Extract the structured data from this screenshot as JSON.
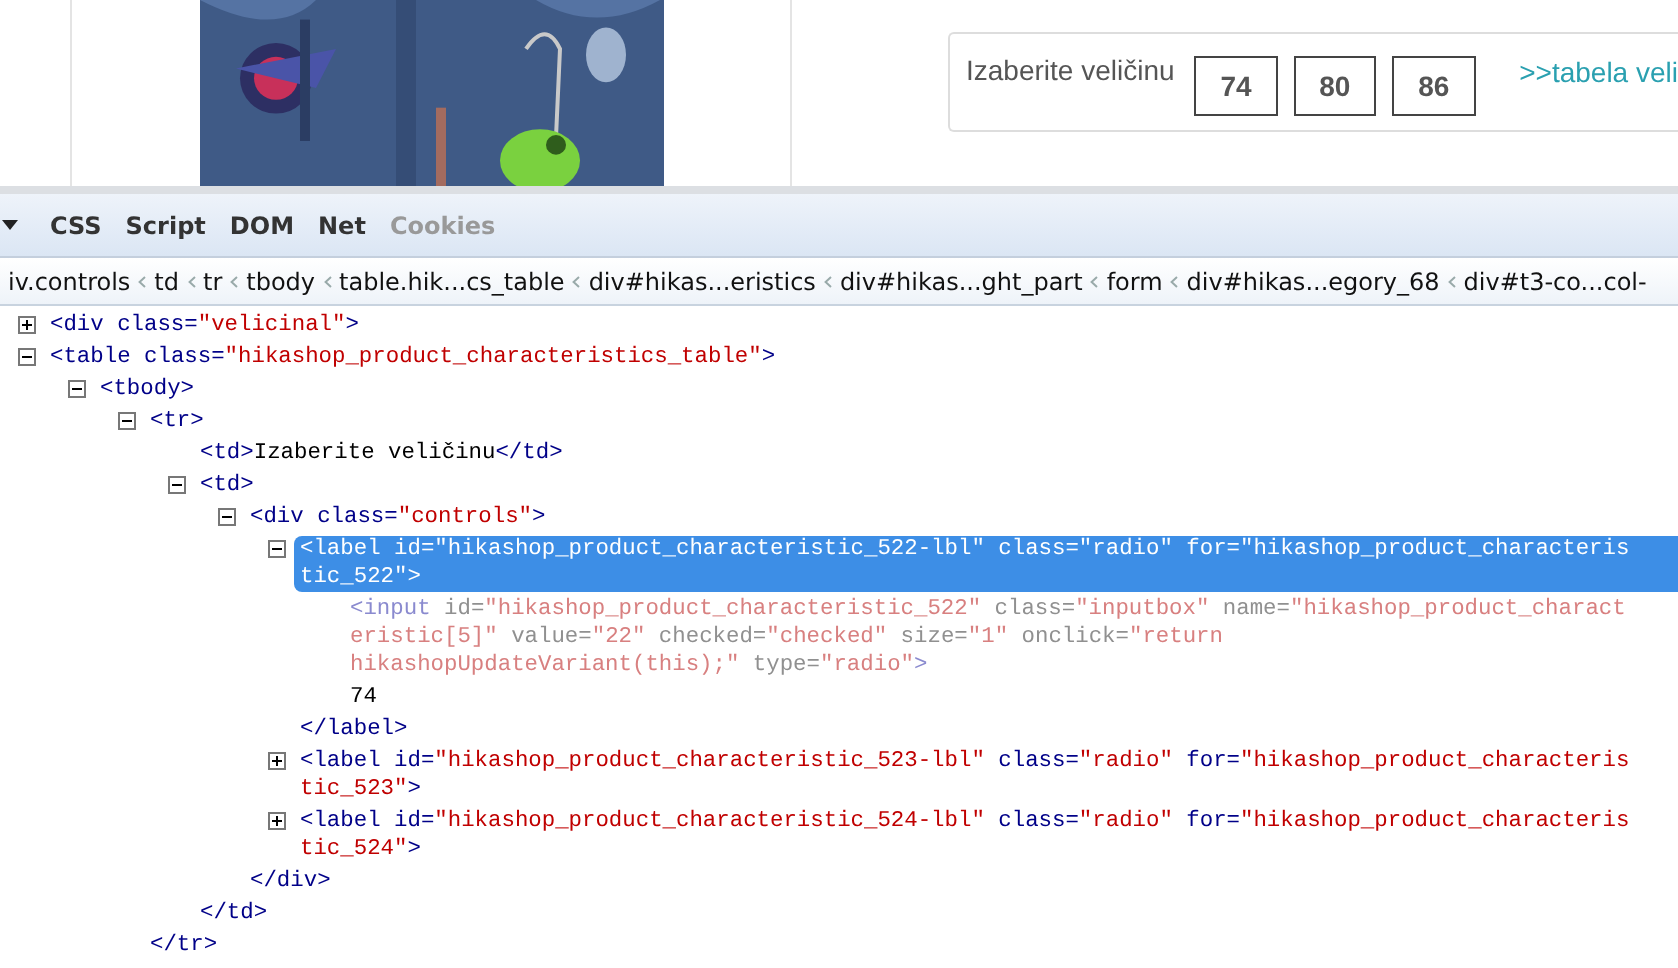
{
  "size_box": {
    "label": "Izaberite veličinu",
    "sizes": [
      "74",
      "80",
      "86"
    ],
    "link": ">>tabela veli"
  },
  "devtools": {
    "tabs": [
      {
        "label": "CSS",
        "disabled": false
      },
      {
        "label": "Script",
        "disabled": false
      },
      {
        "label": "DOM",
        "disabled": false
      },
      {
        "label": "Net",
        "disabled": false
      },
      {
        "label": "Cookies",
        "disabled": true
      }
    ],
    "breadcrumbs": [
      "iv.controls",
      "td",
      "tr",
      "tbody",
      "table.hik...cs_table",
      "div#hikas...eristics",
      "div#hikas...ght_part",
      "form",
      "div#hikas...egory_68",
      "div#t3-co...col-"
    ],
    "tree": [
      {
        "kind": "node",
        "expanded": false,
        "selected": false,
        "lines": [
          [
            {
              "kind": "tag",
              "text": "<div"
            },
            {
              "kind": "attr",
              "text": " class="
            },
            {
              "kind": "value",
              "text": "\"velicinal\""
            },
            {
              "kind": "tag",
              "text": ">"
            }
          ]
        ]
      },
      {
        "kind": "node",
        "expanded": true,
        "selected": false,
        "lines": [
          [
            {
              "kind": "tag",
              "text": "<table"
            },
            {
              "kind": "attr",
              "text": " class="
            },
            {
              "kind": "value",
              "text": "\"hikashop_product_characteristics_table\""
            },
            {
              "kind": "tag",
              "text": ">"
            }
          ]
        ],
        "children": [
          {
            "kind": "node",
            "expanded": true,
            "selected": false,
            "lines": [
              [
                {
                  "kind": "tag",
                  "text": "<tbody>"
                }
              ]
            ],
            "children": [
              {
                "kind": "node",
                "expanded": true,
                "selected": false,
                "lines": [
                  [
                    {
                      "kind": "tag",
                      "text": "<tr>"
                    }
                  ]
                ],
                "children": [
                  {
                    "kind": "leaf",
                    "lines": [
                      [
                        {
                          "kind": "tag",
                          "text": "<td>"
                        },
                        {
                          "kind": "text",
                          "text": "Izaberite veličinu"
                        },
                        {
                          "kind": "tag",
                          "text": "</td>"
                        }
                      ]
                    ]
                  },
                  {
                    "kind": "node",
                    "expanded": true,
                    "selected": false,
                    "lines": [
                      [
                        {
                          "kind": "tag",
                          "text": "<td>"
                        }
                      ]
                    ],
                    "children": [
                      {
                        "kind": "node",
                        "expanded": true,
                        "selected": false,
                        "lines": [
                          [
                            {
                              "kind": "tag",
                              "text": "<div"
                            },
                            {
                              "kind": "attr",
                              "text": " class="
                            },
                            {
                              "kind": "value",
                              "text": "\"controls\""
                            },
                            {
                              "kind": "tag",
                              "text": ">"
                            }
                          ]
                        ],
                        "children": [
                          {
                            "kind": "node",
                            "expanded": true,
                            "selected": true,
                            "lines": [
                              [
                                {
                                  "kind": "tag",
                                  "text": "<label"
                                },
                                {
                                  "kind": "attr",
                                  "text": " id="
                                },
                                {
                                  "kind": "value",
                                  "text": "\"hikashop_product_characteristic_522-lbl\""
                                },
                                {
                                  "kind": "attr",
                                  "text": " class="
                                },
                                {
                                  "kind": "value",
                                  "text": "\"radio\""
                                },
                                {
                                  "kind": "attr",
                                  "text": " for="
                                },
                                {
                                  "kind": "value",
                                  "text": "\"hikashop_product_characteris"
                                }
                              ],
                              [
                                {
                                  "kind": "value",
                                  "text": "tic_522\""
                                },
                                {
                                  "kind": "tag",
                                  "text": ">"
                                }
                              ]
                            ],
                            "children": [
                              {
                                "kind": "hidden",
                                "lines": [
                                  [
                                    {
                                      "kind": "tag",
                                      "text": "<input"
                                    },
                                    {
                                      "kind": "attr",
                                      "text": " id="
                                    },
                                    {
                                      "kind": "value",
                                      "text": "\"hikashop_product_characteristic_522\""
                                    },
                                    {
                                      "kind": "attr",
                                      "text": " class="
                                    },
                                    {
                                      "kind": "value",
                                      "text": "\"inputbox\""
                                    },
                                    {
                                      "kind": "attr",
                                      "text": " name="
                                    },
                                    {
                                      "kind": "value",
                                      "text": "\"hikashop_product_charact"
                                    }
                                  ],
                                  [
                                    {
                                      "kind": "value",
                                      "text": "eristic[5]\""
                                    },
                                    {
                                      "kind": "attr",
                                      "text": " value="
                                    },
                                    {
                                      "kind": "value",
                                      "text": "\"22\""
                                    },
                                    {
                                      "kind": "attr",
                                      "text": " checked="
                                    },
                                    {
                                      "kind": "value",
                                      "text": "\"checked\""
                                    },
                                    {
                                      "kind": "attr",
                                      "text": " size="
                                    },
                                    {
                                      "kind": "value",
                                      "text": "\"1\""
                                    },
                                    {
                                      "kind": "attr",
                                      "text": " onclick="
                                    },
                                    {
                                      "kind": "value",
                                      "text": "\"return"
                                    }
                                  ],
                                  [
                                    {
                                      "kind": "value",
                                      "text": "hikashopUpdateVariant(this);\""
                                    },
                                    {
                                      "kind": "attr",
                                      "text": " type="
                                    },
                                    {
                                      "kind": "value",
                                      "text": "\"radio\""
                                    },
                                    {
                                      "kind": "tag",
                                      "text": ">"
                                    }
                                  ]
                                ]
                              },
                              {
                                "kind": "text",
                                "lines": [
                                  [
                                    {
                                      "kind": "text",
                                      "text": "74"
                                    }
                                  ]
                                ]
                              }
                            ],
                            "close": [
                              {
                                "kind": "tag",
                                "text": "</label>"
                              }
                            ]
                          },
                          {
                            "kind": "node",
                            "expanded": false,
                            "selected": false,
                            "lines": [
                              [
                                {
                                  "kind": "tag",
                                  "text": "<label"
                                },
                                {
                                  "kind": "attr",
                                  "text": " id="
                                },
                                {
                                  "kind": "value",
                                  "text": "\"hikashop_product_characteristic_523-lbl\""
                                },
                                {
                                  "kind": "attr",
                                  "text": " class="
                                },
                                {
                                  "kind": "value",
                                  "text": "\"radio\""
                                },
                                {
                                  "kind": "attr",
                                  "text": " for="
                                },
                                {
                                  "kind": "value",
                                  "text": "\"hikashop_product_characteris"
                                }
                              ],
                              [
                                {
                                  "kind": "value",
                                  "text": "tic_523\""
                                },
                                {
                                  "kind": "tag",
                                  "text": ">"
                                }
                              ]
                            ]
                          },
                          {
                            "kind": "node",
                            "expanded": false,
                            "selected": false,
                            "lines": [
                              [
                                {
                                  "kind": "tag",
                                  "text": "<label"
                                },
                                {
                                  "kind": "attr",
                                  "text": " id="
                                },
                                {
                                  "kind": "value",
                                  "text": "\"hikashop_product_characteristic_524-lbl\""
                                },
                                {
                                  "kind": "attr",
                                  "text": " class="
                                },
                                {
                                  "kind": "value",
                                  "text": "\"radio\""
                                },
                                {
                                  "kind": "attr",
                                  "text": " for="
                                },
                                {
                                  "kind": "value",
                                  "text": "\"hikashop_product_characteris"
                                }
                              ],
                              [
                                {
                                  "kind": "value",
                                  "text": "tic_524\""
                                },
                                {
                                  "kind": "tag",
                                  "text": ">"
                                }
                              ]
                            ]
                          }
                        ],
                        "close": [
                          {
                            "kind": "tag",
                            "text": "</div>"
                          }
                        ]
                      }
                    ],
                    "close": [
                      {
                        "kind": "tag",
                        "text": "</td>"
                      }
                    ]
                  }
                ],
                "close": [
                  {
                    "kind": "tag",
                    "text": "</tr>"
                  }
                ]
              }
            ]
          }
        ]
      }
    ]
  }
}
